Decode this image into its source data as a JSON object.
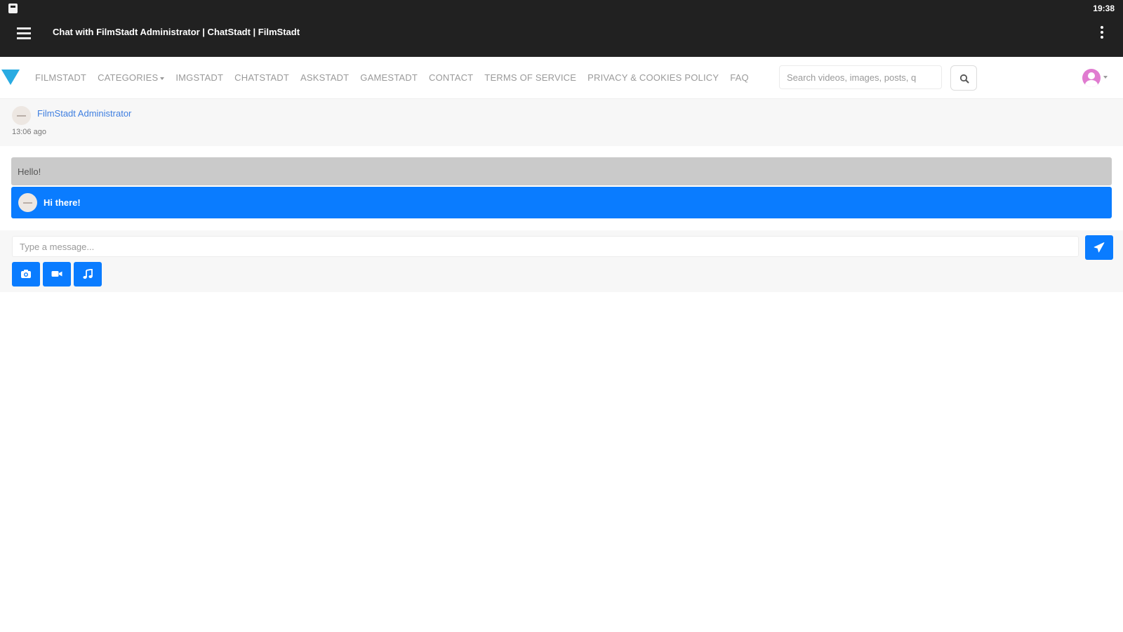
{
  "status_bar": {
    "time": "19:38"
  },
  "app_bar": {
    "title": "Chat with FilmStadt Administrator | ChatStadt | FilmStadt"
  },
  "nav": {
    "links": [
      "FILMSTADT",
      "CATEGORIES",
      "IMGSTADT",
      "CHATSTADT",
      "ASKSTADT",
      "GAMESTADT",
      "CONTACT",
      "TERMS OF SERVICE",
      "PRIVACY & COOKIES POLICY",
      "FAQ"
    ],
    "search_placeholder": "Search videos, images, posts, q"
  },
  "chat": {
    "contact_name": "FilmStadt Administrator",
    "last_seen": "13:06 ago",
    "messages": [
      {
        "direction": "incoming",
        "text": "Hello!"
      },
      {
        "direction": "outgoing",
        "text": "Hi there!"
      }
    ],
    "composer": {
      "placeholder": "Type a message...",
      "media_buttons": [
        "camera-icon",
        "video-icon",
        "music-icon"
      ]
    }
  },
  "colors": {
    "app_bar": "#212121",
    "accent": "#0a7cff",
    "incoming_bubble": "#cacaca",
    "link": "#3f7fe0",
    "logo": "#29abe2"
  }
}
